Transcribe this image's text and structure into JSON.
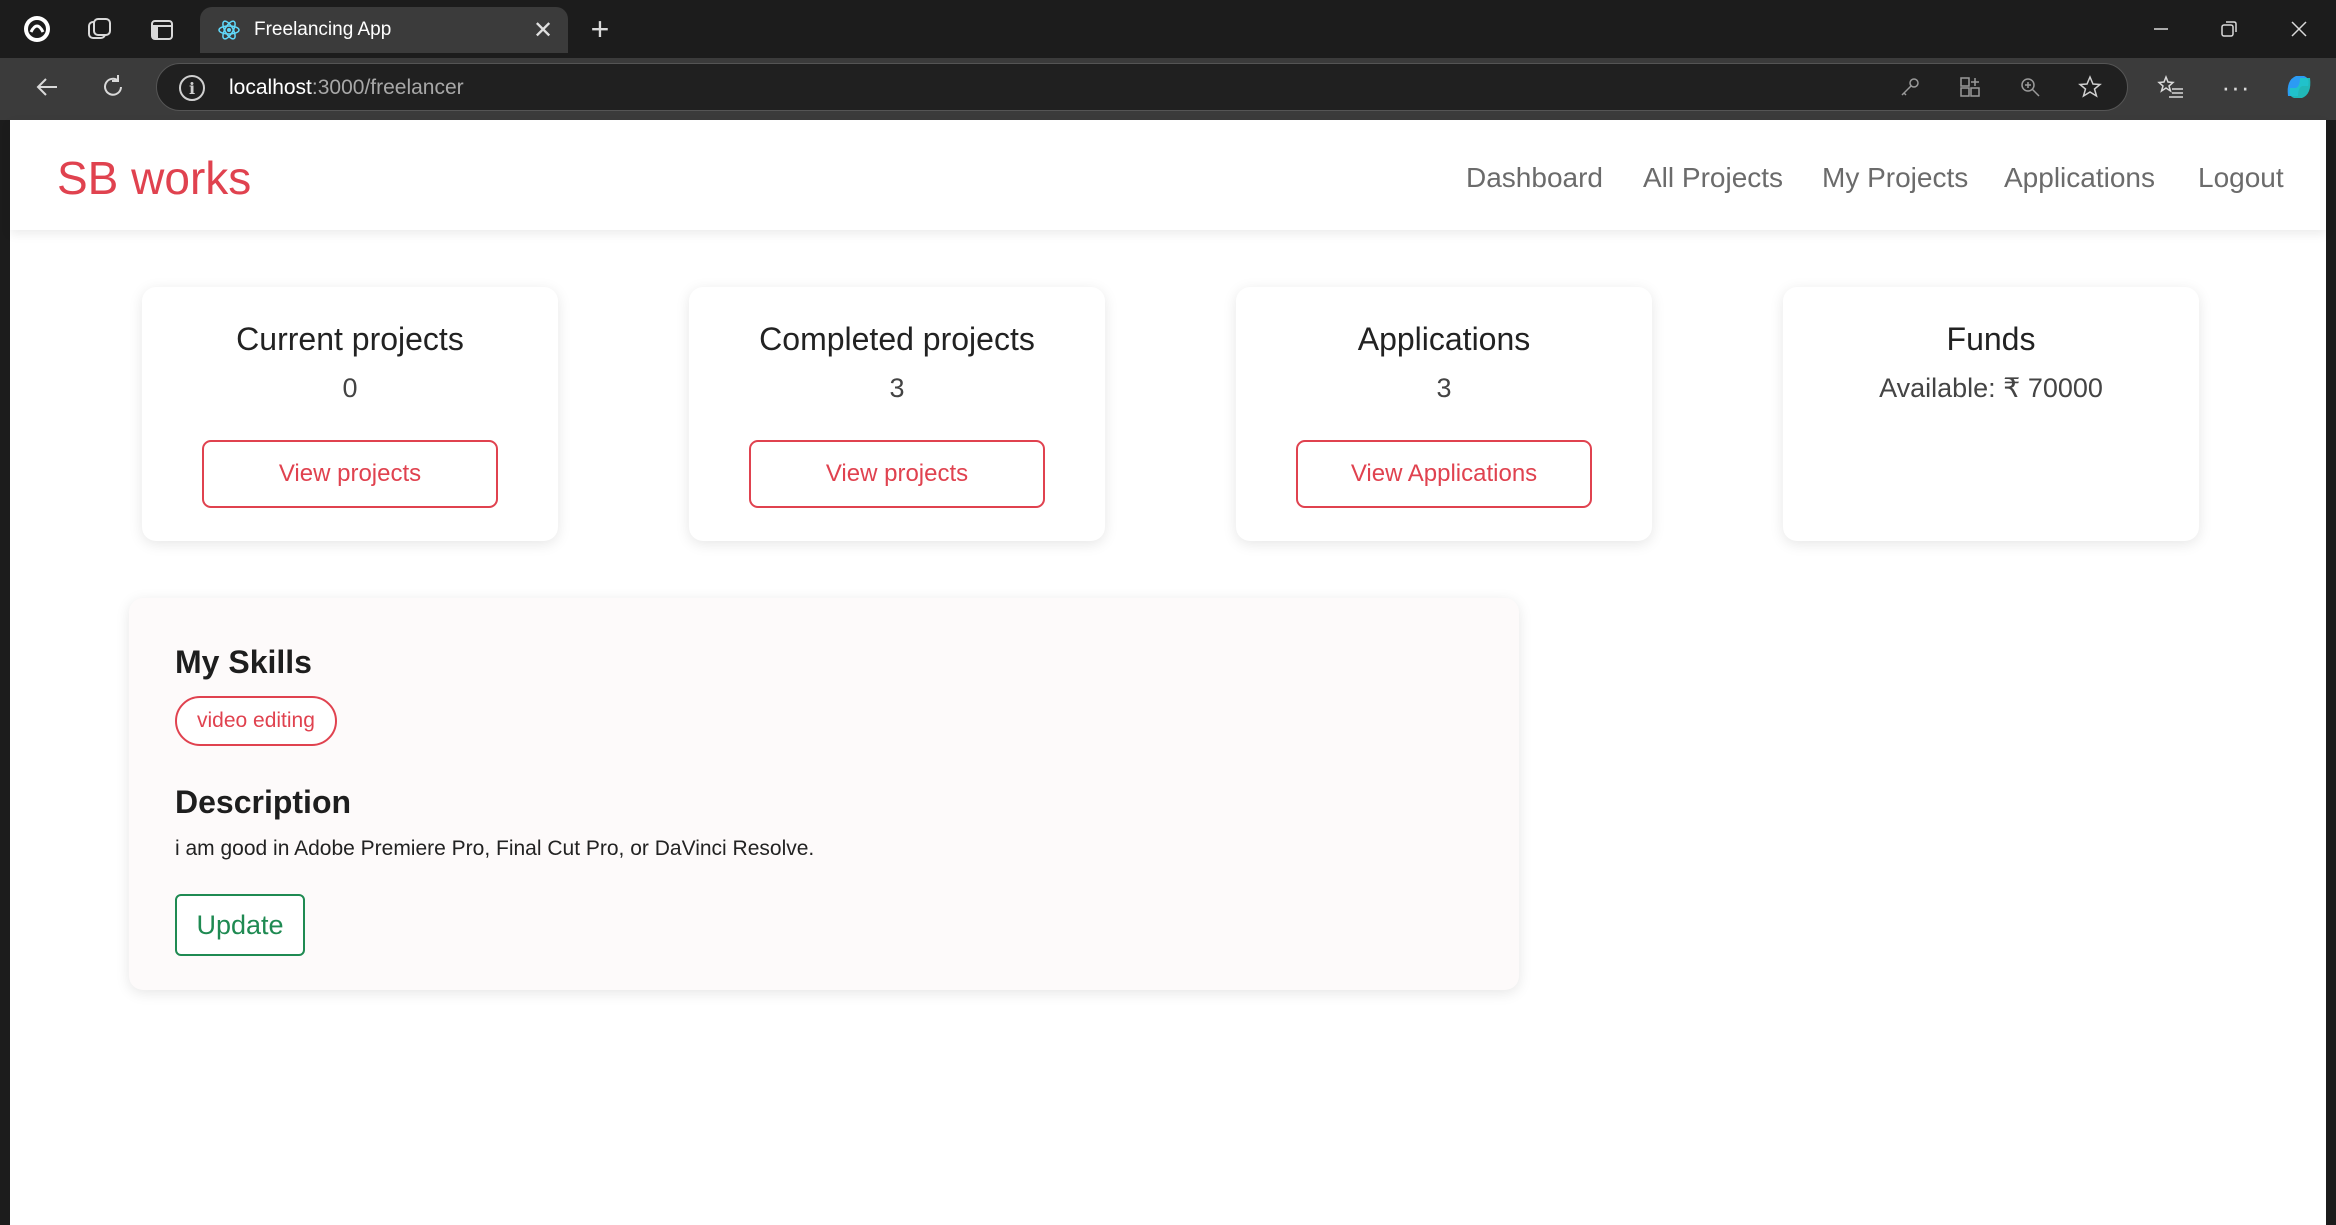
{
  "browser": {
    "tab_title": "Freelancing App",
    "address_host": "localhost",
    "address_path": ":3000/freelancer",
    "icons": [
      "profile-icon",
      "collections-icon",
      "sidebar-icon",
      "react-icon",
      "close-icon",
      "new-tab-icon",
      "back-icon",
      "refresh-icon",
      "info-icon",
      "key-icon",
      "apps-icon",
      "zoom-icon",
      "favorite-star-icon",
      "favorites-list-icon",
      "more-icon",
      "copilot-icon",
      "minimize-icon",
      "restore-icon",
      "window-close-icon"
    ]
  },
  "navbar": {
    "brand": "SB works",
    "links": {
      "dashboard": "Dashboard",
      "all_projects": "All Projects",
      "my_projects": "My Projects",
      "applications": "Applications",
      "logout": "Logout"
    }
  },
  "cards": {
    "current": {
      "title": "Current projects",
      "value": "0",
      "button": "View projects"
    },
    "completed": {
      "title": "Completed projects",
      "value": "3",
      "button": "View projects"
    },
    "applications": {
      "title": "Applications",
      "value": "3",
      "button": "View Applications"
    },
    "funds": {
      "title": "Funds",
      "value": "Available: ₹ 70000"
    }
  },
  "profile": {
    "skills_heading": "My Skills",
    "skills": [
      "video editing"
    ],
    "description_heading": "Description",
    "description": "i am good in Adobe Premiere Pro, Final Cut Pro, or DaVinci Resolve.",
    "update_button": "Update"
  },
  "colors": {
    "brand": "#e0424f",
    "accent_red": "#e0424f",
    "accent_green": "#1f8a52",
    "chrome_dark": "#1c1c1c",
    "chrome_toolbar": "#3b3b3b"
  }
}
